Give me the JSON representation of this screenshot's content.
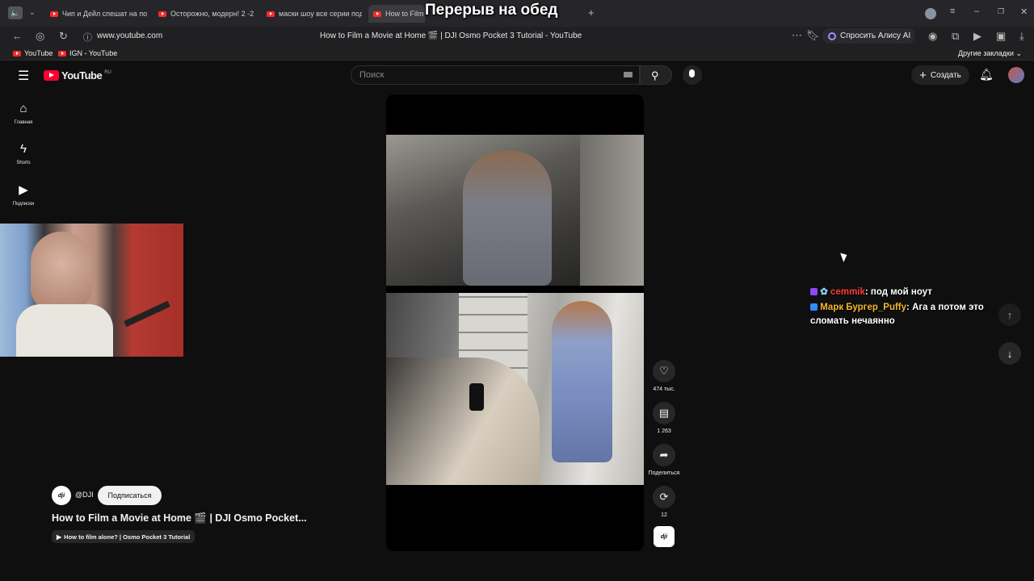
{
  "browser": {
    "overlay_title": "Перерыв на обед",
    "tabs": [
      {
        "label": "Чип и Дейл спешат на по"
      },
      {
        "label": "Осторожно, модерн! 2 -2"
      },
      {
        "label": "маски шоу все серии под"
      },
      {
        "label": "How to Film"
      }
    ],
    "url": "www.youtube.com",
    "page_title": "How to Film a Movie at Home 🎬 | DJI Osmo Pocket 3 Tutorial - YouTube",
    "alice_label": "Спросить Алису AI",
    "bookmarks": [
      {
        "label": "YouTube"
      },
      {
        "label": "IGN - YouTube"
      }
    ],
    "other_bookmarks": "Другие закладки"
  },
  "youtube": {
    "logo_text": "YouTube",
    "logo_region": "RU",
    "search_placeholder": "Поиск",
    "create_label": "Создать",
    "sidebar": [
      {
        "label": "Главная",
        "icon": "home-icon"
      },
      {
        "label": "Shorts",
        "icon": "shorts-icon"
      },
      {
        "label": "Подписки",
        "icon": "subscriptions-icon"
      }
    ],
    "short": {
      "channel": "@DJI",
      "channel_avatar_text": "dji",
      "subscribe_label": "Подписаться",
      "title": "How to Film a Movie at Home 🎬 | DJI Osmo Pocket...",
      "playlist": "How to film alone? | Osmo Pocket 3 Tutorial"
    },
    "actions": {
      "likes": "474 тыс.",
      "comments": "1 263",
      "share": "Поделиться",
      "remix": "12"
    }
  },
  "chat": [
    {
      "user": "cemmik",
      "text": ": под мой ноут",
      "color": "#ff3b3b"
    },
    {
      "user": "Марк Бургер_Puffy",
      "text": ": Ага а потом это сломать нечаянно",
      "color": "#f5b531"
    }
  ]
}
